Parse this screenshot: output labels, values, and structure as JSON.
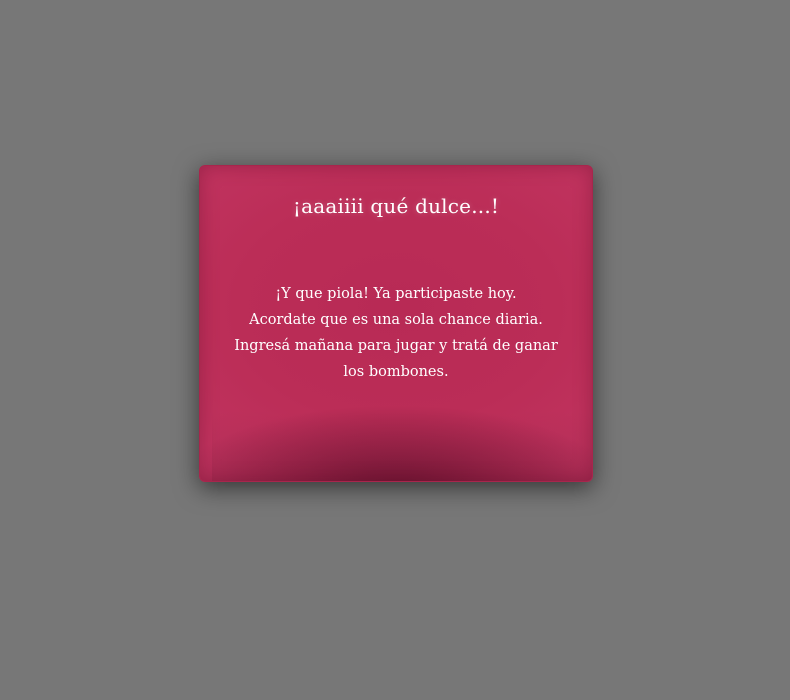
{
  "modal": {
    "title": "¡aaaiiii qué dulce...!",
    "message_lines": [
      "¡Y que piola! Ya participaste hoy.",
      "Acordate que es una sola chance diaria.",
      "Ingresá mañana para jugar y tratá de ganar",
      "los bombones."
    ]
  },
  "colors": {
    "overlay": "#777777",
    "modal_background": "#bb2d57",
    "text": "#ffffff"
  }
}
